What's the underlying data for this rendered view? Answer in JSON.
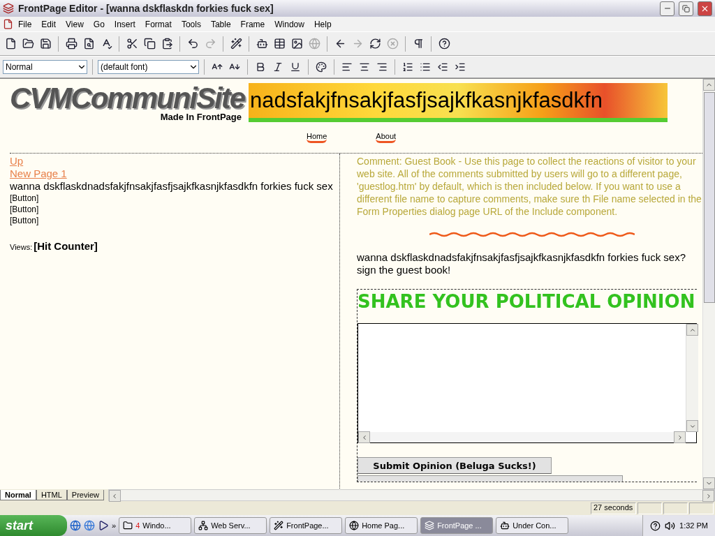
{
  "window": {
    "title": "FrontPage Editor - [wanna dskflaskdn forkies fuck sex]"
  },
  "menu": [
    "File",
    "Edit",
    "View",
    "Go",
    "Insert",
    "Format",
    "Tools",
    "Table",
    "Frame",
    "Window",
    "Help"
  ],
  "toolbar": [
    {
      "disabled": false
    },
    {
      "disabled": false
    },
    {
      "disabled": false
    },
    {
      "disabled": false
    },
    {
      "disabled": false
    },
    {
      "disabled": false
    },
    {
      "disabled": false
    },
    {
      "disabled": false
    },
    {
      "disabled": false
    },
    {
      "disabled": false
    },
    {
      "disabled": true
    },
    {
      "disabled": false
    },
    {
      "disabled": false
    },
    {
      "disabled": false
    },
    {
      "disabled": false
    },
    {
      "disabled": true
    },
    {
      "disabled": false
    },
    {
      "disabled": true
    },
    {
      "disabled": false
    },
    {
      "disabled": true
    },
    {
      "disabled": false
    },
    {
      "disabled": false
    }
  ],
  "format_bar": {
    "style": "Normal",
    "font": "(default font)"
  },
  "page": {
    "logo": "CVMCommuniSite",
    "tagline": "Made In FrontPage",
    "banner": "nadsfakjfnsakjfasfjsajkfkasnjkfasdkfn",
    "nav": [
      "Home",
      "About"
    ],
    "left": {
      "links": [
        "Up",
        "New Page 1"
      ],
      "text": "wanna dskflaskdnadsfakjfnsakjfasfjsajkfkasnjkfasdkfn forkies fuck sex",
      "buttons": [
        "[Button]",
        "[Button]",
        "[Button]"
      ],
      "views_label": "Views:",
      "counter": "[Hit Counter]"
    },
    "right": {
      "comment": "Comment: Guest Book - Use this page to collect the reactions of visitor to your web site. All of the comments submitted by users will go to a different page, 'guestlog.htm' by default, which is then included below. If you want to use a different file name to capture comments, make sure th File name selected in the Form Properties dialog page URL of the Include component.",
      "intro": "wanna dskflaskdnadsfakjfnsakjfasfjsajkfkasnjkfasdkfn forkies fuck sex? sign the guest book!",
      "form_title": "SHARE YOUR POLITICAL OPINION",
      "submit": "Submit Opinion (Beluga Sucks!)"
    }
  },
  "view_tabs": [
    {
      "label": "Normal",
      "selected": true
    },
    {
      "label": "HTML",
      "selected": false
    },
    {
      "label": "Preview",
      "selected": false
    }
  ],
  "status_bar": {
    "time": "27 seconds"
  },
  "taskbar": {
    "start": "start",
    "more": "»",
    "tasks": [
      {
        "label": "Windo...",
        "count": "4",
        "selected": false
      },
      {
        "label": "Web Serv...",
        "selected": false
      },
      {
        "label": "FrontPage...",
        "selected": false
      },
      {
        "label": "Home Pag...",
        "selected": false
      },
      {
        "label": "FrontPage ...",
        "selected": true
      },
      {
        "label": "Under Con...",
        "selected": false
      }
    ],
    "clock": "1:32 PM"
  }
}
